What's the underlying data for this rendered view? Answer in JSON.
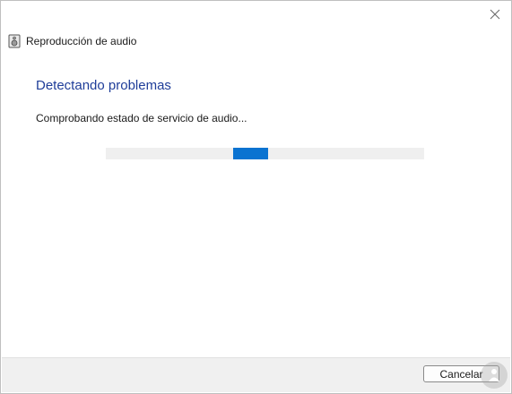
{
  "window": {
    "title": "Reproducción de audio"
  },
  "main": {
    "heading": "Detectando problemas",
    "status": "Comprobando estado de servicio de audio..."
  },
  "progress": {
    "indeterminate": true
  },
  "footer": {
    "cancel_label": "Cancelar"
  },
  "colors": {
    "heading": "#1f3d99",
    "progress_fill": "#0a73d1",
    "progress_track": "#efefef",
    "footer_bg": "#f0f0f0"
  },
  "icons": {
    "app": "speaker-icon",
    "close": "close-icon",
    "watermark": "person-logo-icon"
  }
}
